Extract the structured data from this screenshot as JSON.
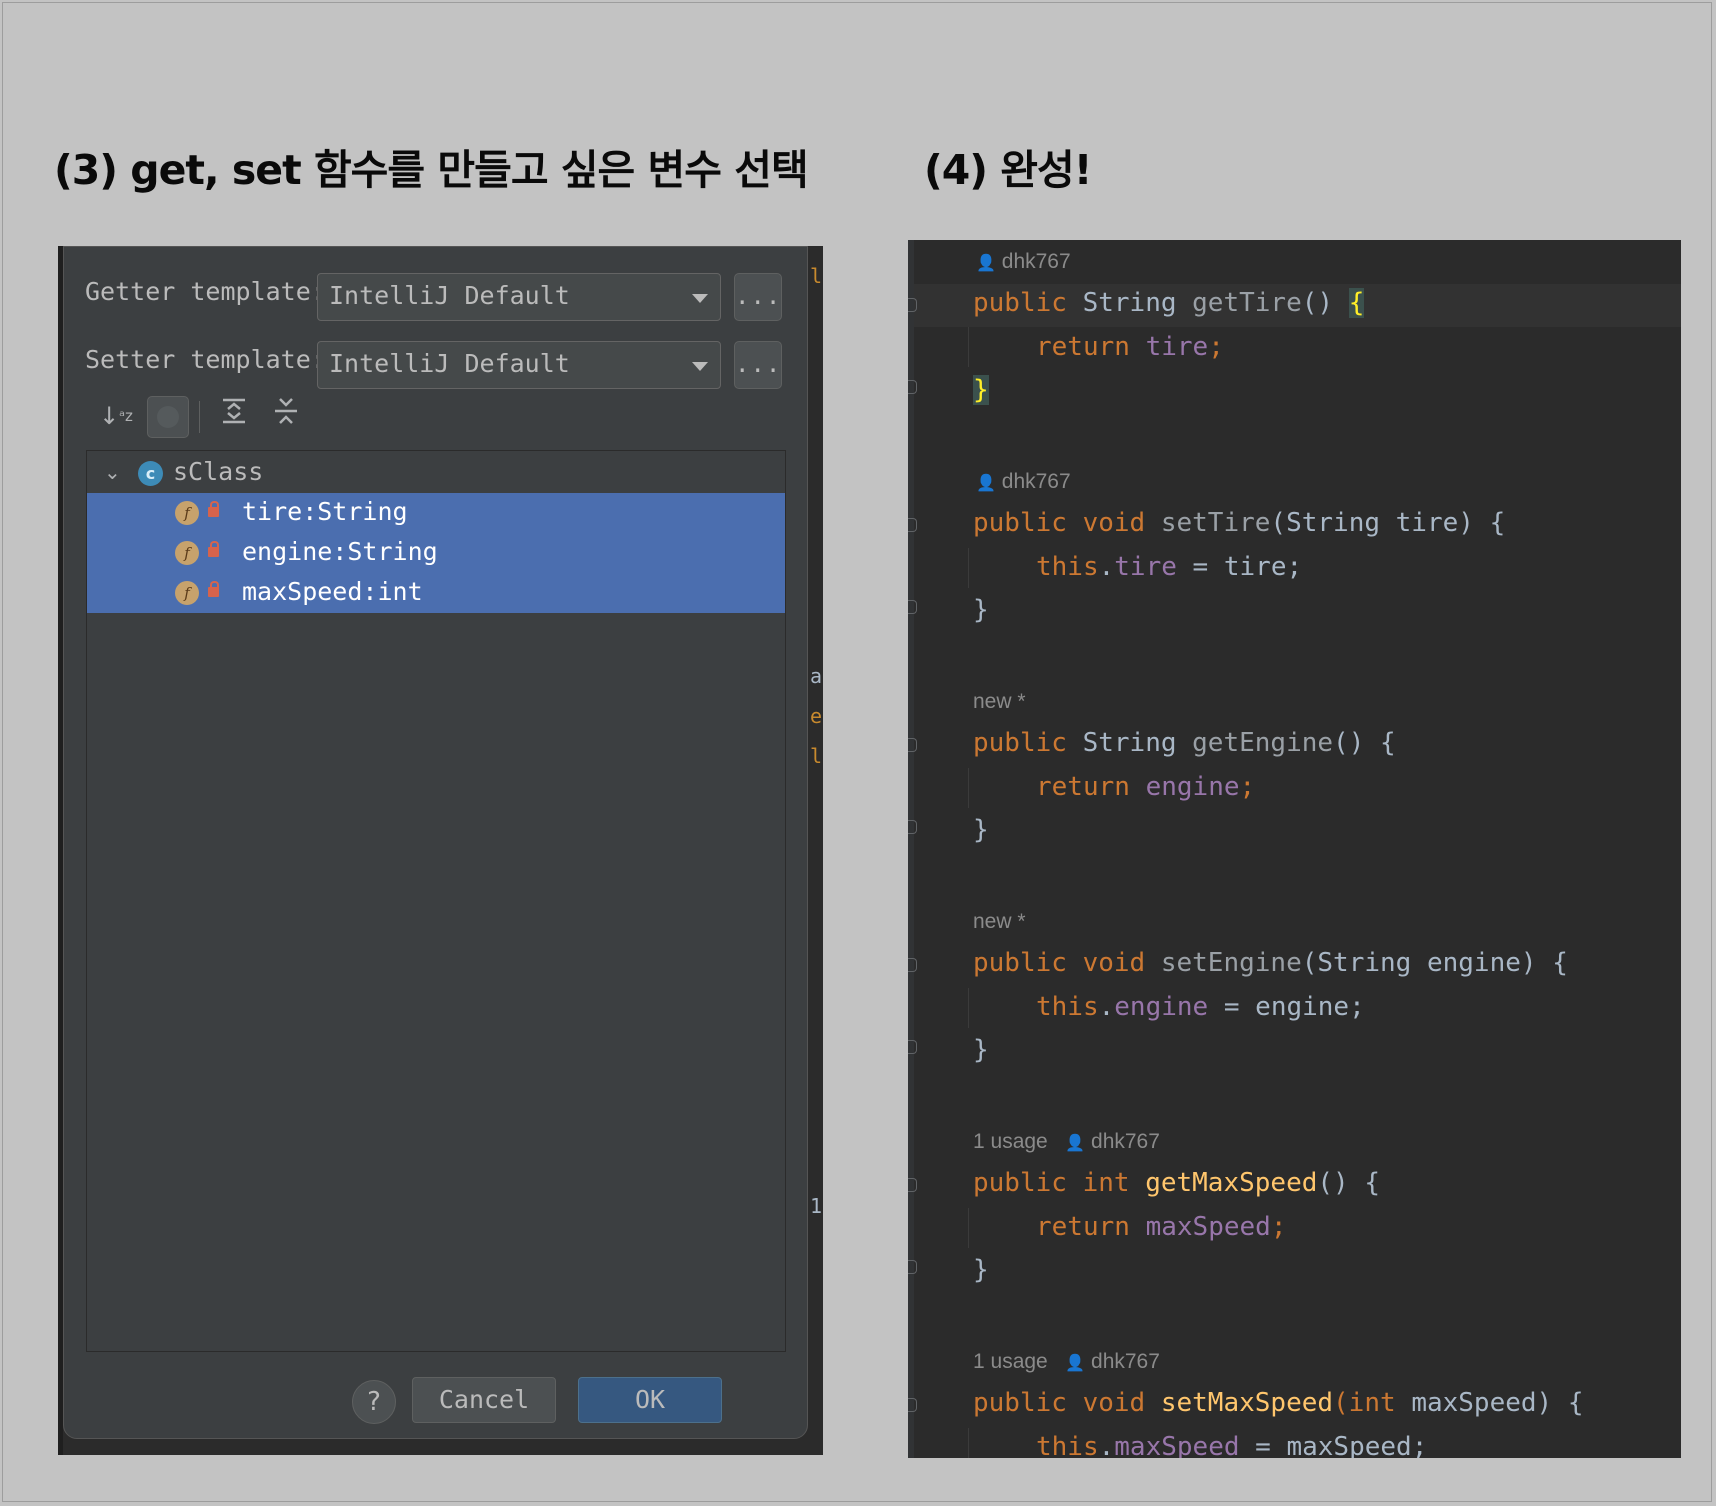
{
  "captions": {
    "left": "(3) get, set 함수를 만들고 싶은 변수 선택",
    "right": "(4) 완성!"
  },
  "dialog": {
    "getter_label": "Getter template:",
    "getter_value": "IntelliJ Default",
    "setter_label": "Setter template:",
    "setter_value": "IntelliJ Default",
    "more_label": "...",
    "tree": {
      "class_name": "sClass",
      "fields": [
        "tire:String",
        "engine:String",
        "maxSpeed:int"
      ]
    },
    "buttons": {
      "help": "?",
      "cancel": "Cancel",
      "ok": "OK"
    }
  },
  "editor": {
    "hints": {
      "author": "dhk767",
      "new": "new *",
      "usage": "1 usage"
    },
    "code": {
      "m1": {
        "mods": "public ",
        "type": "String ",
        "name": "getTire",
        "rest": "() ",
        "open": "{",
        "ret_kw": "return ",
        "ret_val": "tire",
        "semi": ";",
        "close": "}"
      },
      "m2": {
        "mods": "public void ",
        "name": "setTire",
        "rest": "(String tire) {",
        "this_kw": "this",
        "dot": ".",
        "field": "tire",
        "assign": " = tire;",
        "close": "}"
      },
      "m3": {
        "mods": "public ",
        "type": "String ",
        "name": "getEngine",
        "rest": "() {",
        "ret_kw": "return ",
        "ret_val": "engine",
        "semi": ";",
        "close": "}"
      },
      "m4": {
        "mods": "public void ",
        "name": "setEngine",
        "rest": "(String engine) {",
        "this_kw": "this",
        "dot": ".",
        "field": "engine",
        "assign": " = engine;",
        "close": "}"
      },
      "m5": {
        "mods": "public int ",
        "name": "getMaxSpeed",
        "rest": "() {",
        "ret_kw": "return ",
        "ret_val": "maxSpeed",
        "semi": ";",
        "close": "}"
      },
      "m6": {
        "mods": "public void ",
        "name": "setMaxSpeed",
        "rest_kw": "(int ",
        "rest": "maxSpeed) {",
        "this_kw": "this",
        "dot": ".",
        "field": "maxSpeed",
        "assign": " = maxSpeed;"
      }
    }
  },
  "colors": {
    "keyword": "#cc7832",
    "method": "#ffc66d",
    "field": "#9876aa",
    "selection": "#4b6eaf"
  }
}
